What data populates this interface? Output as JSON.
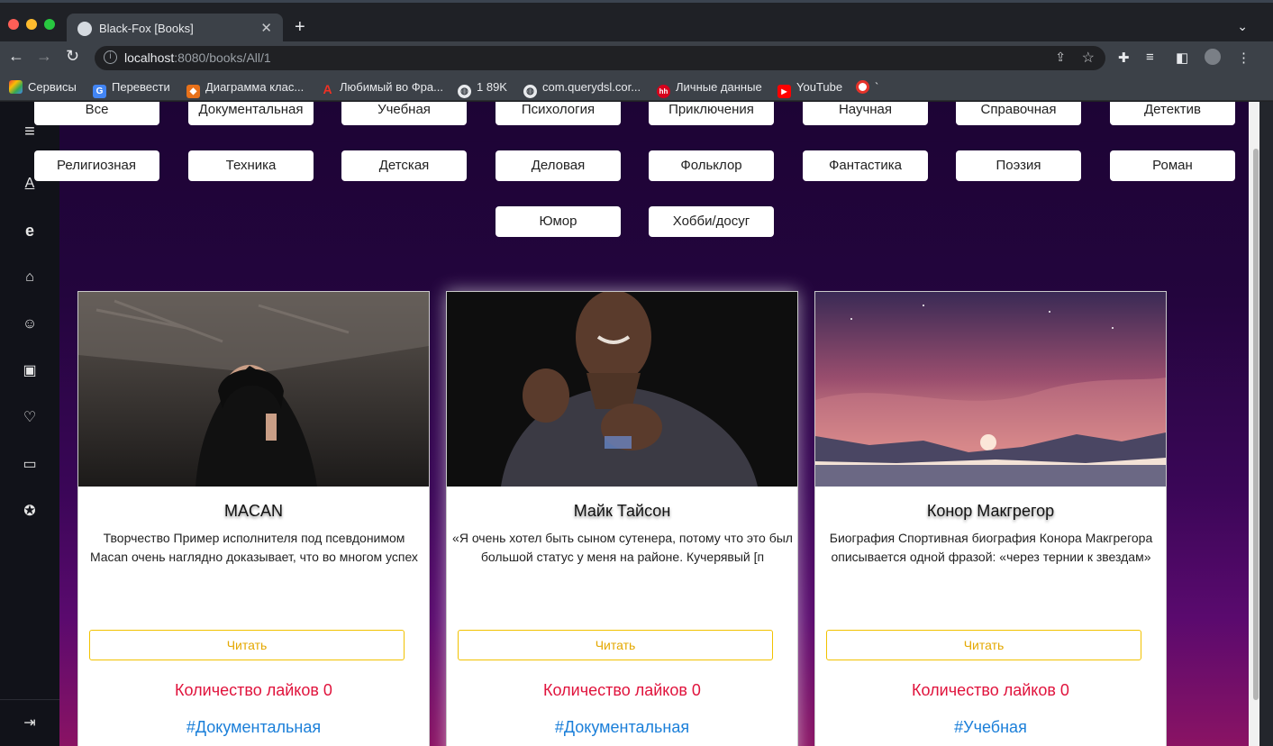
{
  "browser": {
    "tab_title": "Black-Fox [Books]",
    "url_host": "localhost",
    "url_path": ":8080/books/All/1",
    "bookmarks": [
      {
        "label": "Сервисы",
        "icon": "apps-icon"
      },
      {
        "label": "Перевести",
        "icon": "translate-icon"
      },
      {
        "label": "Диаграмма клас...",
        "icon": "diagram-icon"
      },
      {
        "label": "Любимый во Фра...",
        "icon": "a-logo-icon"
      },
      {
        "label": "1 89K",
        "icon": "globe-icon"
      },
      {
        "label": "com.querydsl.cor...",
        "icon": "globe-icon"
      },
      {
        "label": "Личные данные",
        "icon": "hh-icon"
      },
      {
        "label": "YouTube",
        "icon": "youtube-icon"
      },
      {
        "label": "`",
        "icon": "target-icon"
      }
    ]
  },
  "categories": {
    "row1": [
      "Все",
      "Документальная",
      "Учебная",
      "Психология",
      "Приключения",
      "Научная",
      "Справочная",
      "Детектив"
    ],
    "row2": [
      "Религиозная",
      "Техника",
      "Детская",
      "Деловая",
      "Фольклор",
      "Фантастика",
      "Поэзия",
      "Роман"
    ],
    "row3": [
      "Юмор",
      "Хобби/досуг"
    ]
  },
  "books": [
    {
      "title": "MACAN",
      "description": "Творчество Пример исполнителя под псевдонимом Macan очень наглядно доказывает, что во многом успех",
      "read_label": "Читать",
      "likes": "Количество лайков 0",
      "tag": "#Документальная"
    },
    {
      "title": "Майк Тайсон",
      "description": "«Я очень хотел быть сыном сутенера, потому что это был большой статус у меня на районе. Кучерявый [п",
      "read_label": "Читать",
      "likes": "Количество лайков 0",
      "tag": "#Документальная"
    },
    {
      "title": "Конор Макгрегор",
      "description": "Биография Спортивная биография Конора Макгрегора описывается одной фразой: «через тернии к звездам»",
      "read_label": "Читать",
      "likes": "Количество лайков 0",
      "tag": "#Учебная"
    }
  ],
  "colors": {
    "likes": "#e0133c",
    "tag": "#1b7fd9",
    "read_border": "#f2c200"
  }
}
